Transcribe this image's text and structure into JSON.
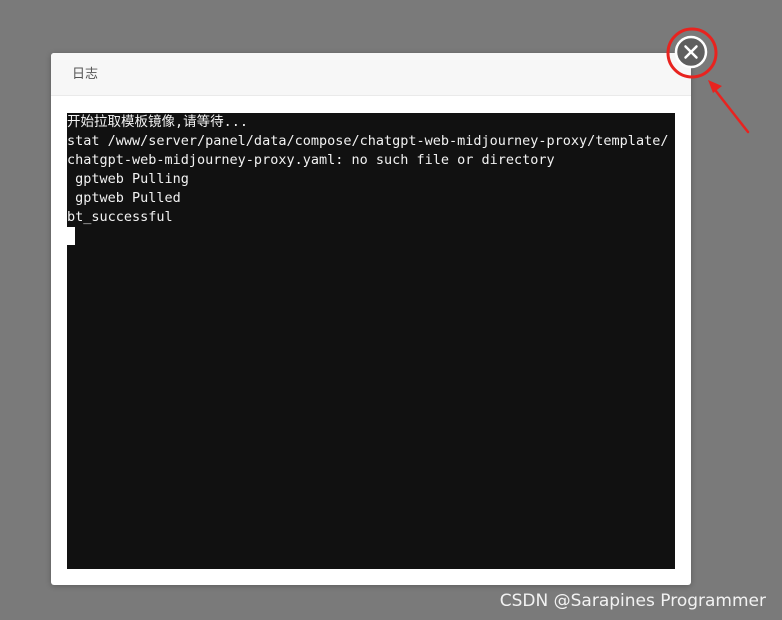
{
  "dialog": {
    "title": "日志"
  },
  "terminal": {
    "lines": [
      "开始拉取模板镜像,请等待...",
      "stat /www/server/panel/data/compose/chatgpt-web-midjourney-proxy/template/",
      "chatgpt-web-midjourney-proxy.yaml: no such file or directory",
      " gptweb Pulling",
      " gptweb Pulled",
      "bt_successful"
    ]
  },
  "close_button": {
    "icon": "close-circle-icon"
  },
  "annotation": {
    "color": "#e8231f"
  },
  "watermark": {
    "text": "CSDN @Sarapines Programmer"
  }
}
